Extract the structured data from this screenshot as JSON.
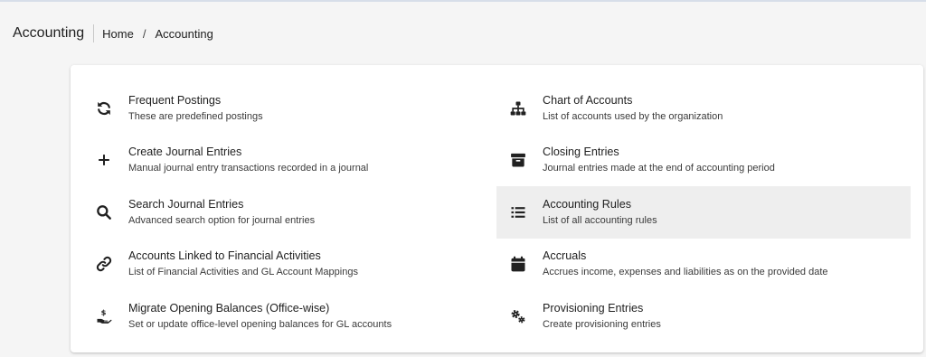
{
  "header": {
    "title": "Accounting",
    "breadcrumb": [
      "Home",
      "Accounting"
    ],
    "separator": "/"
  },
  "colors": {
    "background": "#f5f5f5",
    "card": "#ffffff",
    "active_item": "#eeeeee",
    "text": "#212121"
  },
  "menu": {
    "left": [
      {
        "title": "Frequent Postings",
        "description": "These are predefined postings",
        "icon": "sync-icon"
      },
      {
        "title": "Create Journal Entries",
        "description": "Manual journal entry transactions recorded in a journal",
        "icon": "plus-icon"
      },
      {
        "title": "Search Journal Entries",
        "description": "Advanced search option for journal entries",
        "icon": "search-icon"
      },
      {
        "title": "Accounts Linked to Financial Activities",
        "description": "List of Financial Activities and GL Account Mappings",
        "icon": "link-icon"
      },
      {
        "title": "Migrate Opening Balances (Office-wise)",
        "description": "Set or update office-level opening balances for GL accounts",
        "icon": "hand-holding-dollar-icon"
      }
    ],
    "right": [
      {
        "title": "Chart of Accounts",
        "description": "List of accounts used by the organization",
        "icon": "sitemap-icon"
      },
      {
        "title": "Closing Entries",
        "description": "Journal entries made at the end of accounting period",
        "icon": "archive-icon"
      },
      {
        "title": "Accounting Rules",
        "description": "List of all accounting rules",
        "icon": "list-icon",
        "active": true
      },
      {
        "title": "Accruals",
        "description": "Accrues income, expenses and liabilities as on the provided date",
        "icon": "calendar-icon"
      },
      {
        "title": "Provisioning Entries",
        "description": "Create provisioning entries",
        "icon": "cogs-icon"
      }
    ]
  }
}
